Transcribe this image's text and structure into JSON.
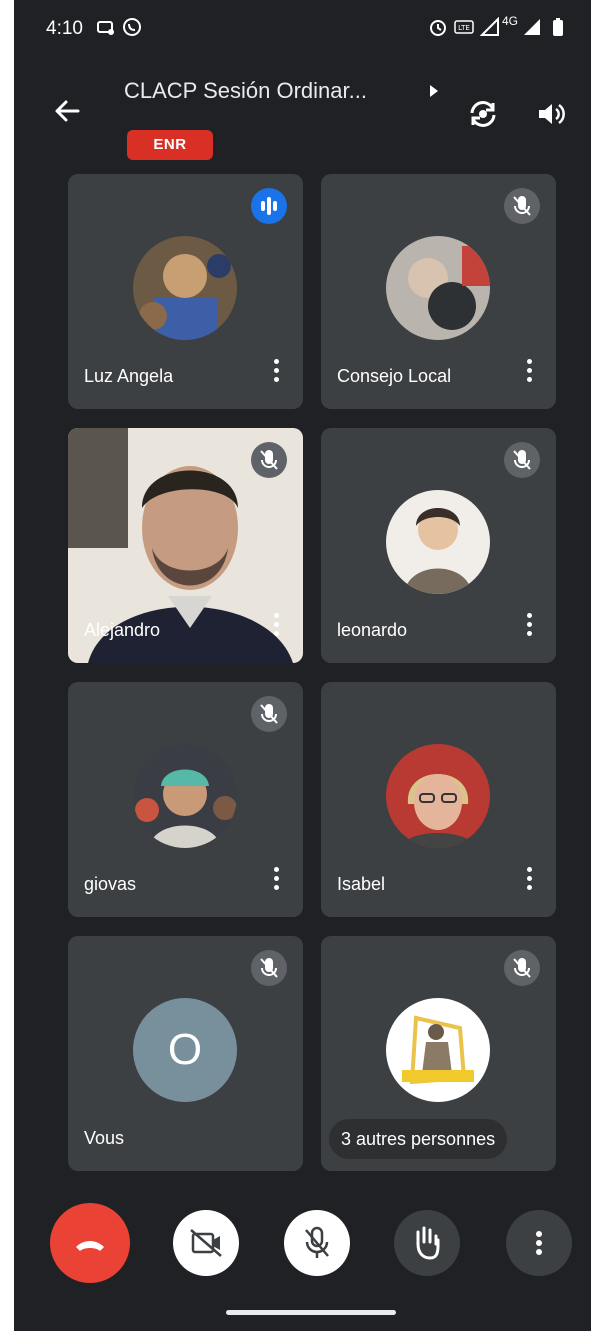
{
  "status_bar": {
    "time": "4:10",
    "network": "4G"
  },
  "header": {
    "title": "CLACP Sesión Ordinar...",
    "recording_badge": "ENR"
  },
  "participants": [
    {
      "name": "Luz Angela",
      "state": "speaking"
    },
    {
      "name": "Consejo Local",
      "state": "muted"
    },
    {
      "name": "Alejandro",
      "state": "muted"
    },
    {
      "name": "leonardo",
      "state": "muted"
    },
    {
      "name": "giovas",
      "state": "muted"
    },
    {
      "name": "Isabel",
      "state": "muted"
    },
    {
      "name": "Vous",
      "initial": "O",
      "state": "muted"
    },
    {
      "name": "3 autres personnes",
      "state": "muted"
    }
  ],
  "controls": [
    {
      "name": "end-call",
      "icon": "phone-hangup-icon",
      "color": "#ea4335"
    },
    {
      "name": "camera-off",
      "icon": "camera-off-icon",
      "color": "#ffffff"
    },
    {
      "name": "mic-off",
      "icon": "mic-off-icon",
      "color": "#ffffff"
    },
    {
      "name": "raise-hand",
      "icon": "hand-icon",
      "color": "#3c4043"
    },
    {
      "name": "more-options",
      "icon": "more-vert-icon",
      "color": "#3c4043"
    }
  ],
  "colors": {
    "background": "#202124",
    "tile": "#3c4043",
    "recording": "#d93025",
    "speaking": "#1a73e8",
    "muted_badge": "#5f6368"
  }
}
